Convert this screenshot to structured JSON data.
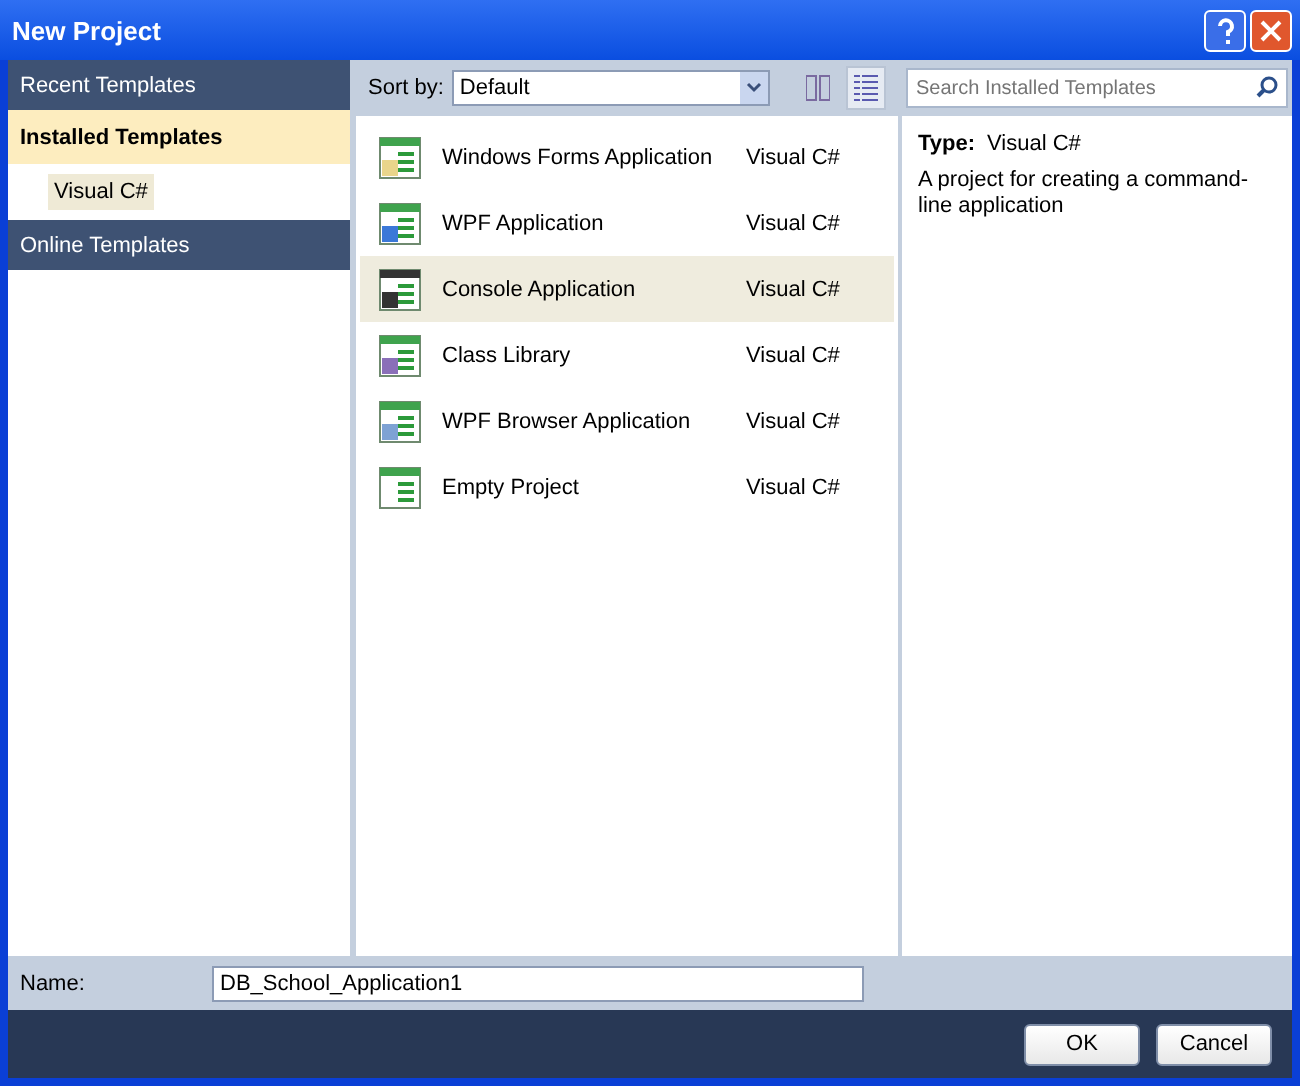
{
  "window": {
    "title": "New Project"
  },
  "sidebar": {
    "items": [
      {
        "kind": "header",
        "label": "Recent Templates",
        "selected": false
      },
      {
        "kind": "group",
        "label": "Installed Templates",
        "selected": true,
        "children": [
          {
            "label": "Visual C#",
            "selected": true
          }
        ]
      },
      {
        "kind": "header",
        "label": "Online Templates",
        "selected": false
      }
    ]
  },
  "toolbar": {
    "sort_label": "Sort by:",
    "sort_value": "Default",
    "views": [
      {
        "kind": "medium",
        "selected": false
      },
      {
        "kind": "small",
        "selected": true
      }
    ],
    "search": {
      "placeholder": "Search Installed Templates"
    }
  },
  "templates": [
    {
      "kind": "forms",
      "name": "Windows Forms Application",
      "language": "Visual C#",
      "selected": false
    },
    {
      "kind": "wpf",
      "name": "WPF Application",
      "language": "Visual C#",
      "selected": false
    },
    {
      "kind": "console",
      "name": "Console Application",
      "language": "Visual C#",
      "selected": true
    },
    {
      "kind": "library",
      "name": "Class Library",
      "language": "Visual C#",
      "selected": false
    },
    {
      "kind": "browser",
      "name": "WPF Browser Application",
      "language": "Visual C#",
      "selected": false
    },
    {
      "kind": "empty",
      "name": "Empty Project",
      "language": "Visual C#",
      "selected": false
    }
  ],
  "details": {
    "type_label": "Type:",
    "type_value": "Visual C#",
    "description": "A project for creating a command-line application"
  },
  "name_field": {
    "label": "Name:",
    "value": "DB_School_Application1"
  },
  "buttons": [
    "OK",
    "Cancel"
  ]
}
